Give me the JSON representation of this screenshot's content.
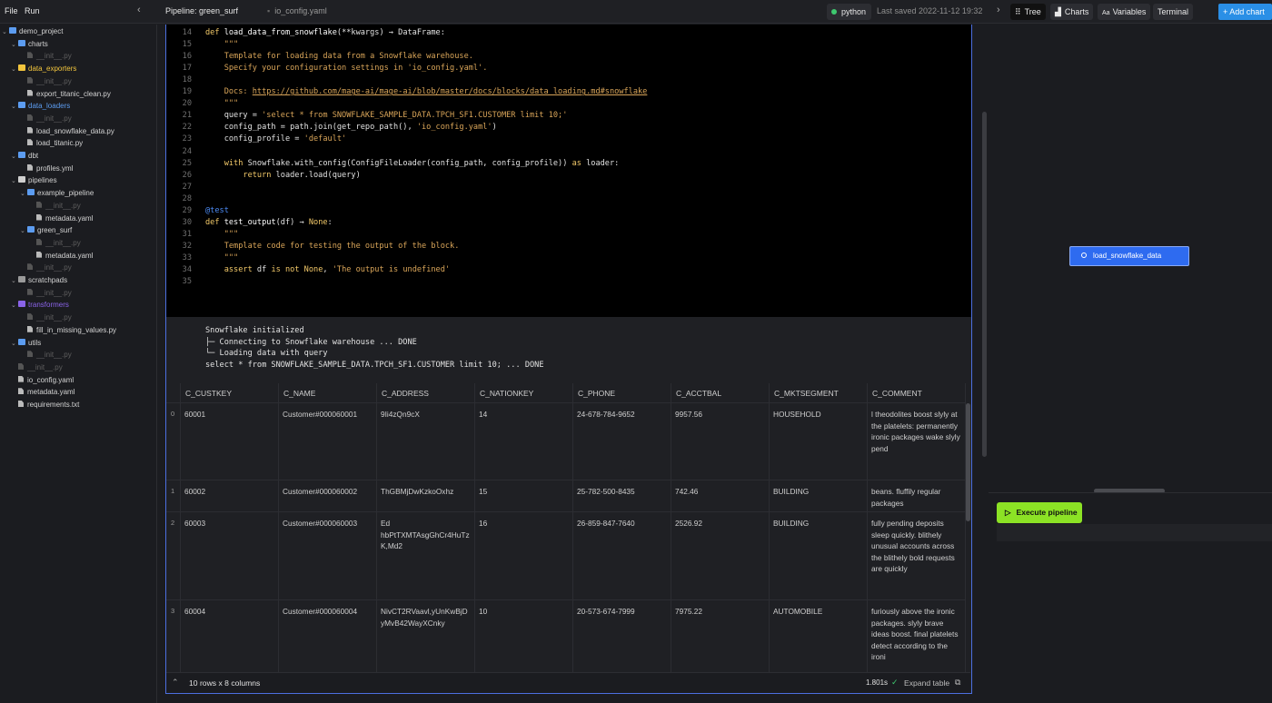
{
  "menu": {
    "file": "File",
    "run": "Run"
  },
  "tabs": {
    "pipeline": "Pipeline: green_surf",
    "ioconfig": "io_config.yaml"
  },
  "lang": "python",
  "last_saved": "Last saved 2022-11-12 19:32",
  "right_tabs": {
    "tree": "Tree",
    "charts": "Charts",
    "variables": "Variables",
    "terminal": "Terminal",
    "add_chart": "+ Add chart"
  },
  "tree": [
    {
      "label": "demo_project",
      "depth": 0,
      "type": "folder",
      "color": "#5c9cf0",
      "expanded": true
    },
    {
      "label": "charts",
      "depth": 1,
      "type": "folder",
      "color": "#5c9cf0",
      "expanded": true
    },
    {
      "label": "__init__.py",
      "depth": 2,
      "type": "file",
      "dim": true
    },
    {
      "label": "data_exporters",
      "depth": 1,
      "type": "folder",
      "color": "#f2c53d",
      "expanded": true,
      "labelColor": "#f2c53d"
    },
    {
      "label": "__init__.py",
      "depth": 2,
      "type": "file",
      "dim": true
    },
    {
      "label": "export_titanic_clean.py",
      "depth": 2,
      "type": "file"
    },
    {
      "label": "data_loaders",
      "depth": 1,
      "type": "folder",
      "color": "#5c9cf0",
      "expanded": true,
      "labelColor": "#5c9cf0"
    },
    {
      "label": "__init__.py",
      "depth": 2,
      "type": "file",
      "dim": true
    },
    {
      "label": "load_snowflake_data.py",
      "depth": 2,
      "type": "file"
    },
    {
      "label": "load_titanic.py",
      "depth": 2,
      "type": "file"
    },
    {
      "label": "dbt",
      "depth": 1,
      "type": "folder",
      "color": "#5c9cf0",
      "expanded": true
    },
    {
      "label": "profiles.yml",
      "depth": 2,
      "type": "file"
    },
    {
      "label": "pipelines",
      "depth": 1,
      "type": "folder",
      "color": "#cfcfcf",
      "expanded": true
    },
    {
      "label": "example_pipeline",
      "depth": 2,
      "type": "folder",
      "color": "#5c9cf0",
      "expanded": true
    },
    {
      "label": "__init__.py",
      "depth": 3,
      "type": "file",
      "dim": true
    },
    {
      "label": "metadata.yaml",
      "depth": 3,
      "type": "file"
    },
    {
      "label": "green_surf",
      "depth": 2,
      "type": "folder",
      "color": "#5c9cf0",
      "expanded": true
    },
    {
      "label": "__init__.py",
      "depth": 3,
      "type": "file",
      "dim": true
    },
    {
      "label": "metadata.yaml",
      "depth": 3,
      "type": "file"
    },
    {
      "label": "__init__.py",
      "depth": 2,
      "type": "file",
      "dim": true
    },
    {
      "label": "scratchpads",
      "depth": 1,
      "type": "folder",
      "color": "#9a9a9a",
      "expanded": true
    },
    {
      "label": "__init__.py",
      "depth": 2,
      "type": "file",
      "dim": true
    },
    {
      "label": "transformers",
      "depth": 1,
      "type": "folder",
      "color": "#8a63e8",
      "expanded": true,
      "labelColor": "#8a63e8"
    },
    {
      "label": "__init__.py",
      "depth": 2,
      "type": "file",
      "dim": true
    },
    {
      "label": "fill_in_missing_values.py",
      "depth": 2,
      "type": "file"
    },
    {
      "label": "utils",
      "depth": 1,
      "type": "folder",
      "color": "#5c9cf0",
      "expanded": true
    },
    {
      "label": "__init__.py",
      "depth": 2,
      "type": "file",
      "dim": true
    },
    {
      "label": "__init__.py",
      "depth": 1,
      "type": "file",
      "dim": true
    },
    {
      "label": "io_config.yaml",
      "depth": 1,
      "type": "file"
    },
    {
      "label": "metadata.yaml",
      "depth": 1,
      "type": "file"
    },
    {
      "label": "requirements.txt",
      "depth": 1,
      "type": "file"
    }
  ],
  "code": [
    {
      "n": "14",
      "tokens": [
        [
          "kw",
          "def "
        ],
        [
          "fn",
          "load_data_from_snowflake"
        ],
        [
          "pl",
          "(**kwargs) → "
        ],
        [
          "pl",
          "DataFrame:"
        ]
      ]
    },
    {
      "n": "15",
      "tokens": [
        [
          "cm",
          "    \"\"\""
        ]
      ]
    },
    {
      "n": "16",
      "tokens": [
        [
          "cm",
          "    Template for loading data from a Snowflake warehouse."
        ]
      ]
    },
    {
      "n": "17",
      "tokens": [
        [
          "cm",
          "    Specify your configuration settings in 'io_config.yaml'."
        ]
      ]
    },
    {
      "n": "18",
      "tokens": []
    },
    {
      "n": "19",
      "tokens": [
        [
          "cm",
          "    Docs: "
        ],
        [
          "link",
          "https://github.com/mage-ai/mage-ai/blob/master/docs/blocks/data_loading.md#snowflake"
        ]
      ]
    },
    {
      "n": "20",
      "tokens": [
        [
          "cm",
          "    \"\"\""
        ]
      ]
    },
    {
      "n": "21",
      "tokens": [
        [
          "pl",
          "    query = "
        ],
        [
          "str",
          "'select * from SNOWFLAKE_SAMPLE_DATA.TPCH_SF1.CUSTOMER limit 10;'"
        ]
      ]
    },
    {
      "n": "22",
      "tokens": [
        [
          "pl",
          "    config_path = path.join(get_repo_path(), "
        ],
        [
          "str",
          "'io_config.yaml'"
        ],
        [
          "pl",
          ")"
        ]
      ]
    },
    {
      "n": "23",
      "tokens": [
        [
          "pl",
          "    config_profile = "
        ],
        [
          "str",
          "'default'"
        ]
      ]
    },
    {
      "n": "24",
      "tokens": []
    },
    {
      "n": "25",
      "tokens": [
        [
          "kw",
          "    with "
        ],
        [
          "pl",
          "Snowflake.with_config(ConfigFileLoader(config_path, config_profile)) "
        ],
        [
          "kw",
          "as "
        ],
        [
          "pl",
          "loader:"
        ]
      ]
    },
    {
      "n": "26",
      "tokens": [
        [
          "kw",
          "        return "
        ],
        [
          "pl",
          "loader.load(query)"
        ]
      ]
    },
    {
      "n": "27",
      "tokens": []
    },
    {
      "n": "28",
      "tokens": []
    },
    {
      "n": "29",
      "tokens": [
        [
          "dec",
          "@test"
        ]
      ]
    },
    {
      "n": "30",
      "tokens": [
        [
          "kw",
          "def "
        ],
        [
          "fn",
          "test_output"
        ],
        [
          "pl",
          "(df) → "
        ],
        [
          "kw",
          "None"
        ],
        [
          "pl",
          ":"
        ]
      ]
    },
    {
      "n": "31",
      "tokens": [
        [
          "cm",
          "    \"\"\""
        ]
      ]
    },
    {
      "n": "32",
      "tokens": [
        [
          "cm",
          "    Template code for testing the output of the block."
        ]
      ]
    },
    {
      "n": "33",
      "tokens": [
        [
          "cm",
          "    \"\"\""
        ]
      ]
    },
    {
      "n": "34",
      "tokens": [
        [
          "kw",
          "    assert "
        ],
        [
          "pl",
          "df "
        ],
        [
          "kw",
          "is not None"
        ],
        [
          "pl",
          ", "
        ],
        [
          "str",
          "'The output is undefined'"
        ]
      ]
    },
    {
      "n": "35",
      "tokens": []
    }
  ],
  "output_lines": [
    "Snowflake initialized",
    "├─ Connecting to Snowflake warehouse ... DONE",
    "└─ Loading data with query",
    "select * from SNOWFLAKE_SAMPLE_DATA.TPCH_SF1.CUSTOMER limit 10; ... DONE"
  ],
  "table": {
    "columns": [
      "C_CUSTKEY",
      "C_NAME",
      "C_ADDRESS",
      "C_NATIONKEY",
      "C_PHONE",
      "C_ACCTBAL",
      "C_MKTSEGMENT",
      "C_COMMENT"
    ],
    "rows": [
      {
        "idx": "0",
        "cells": [
          "60001",
          "Customer#000060001",
          "9Ii4zQn9cX",
          "14",
          "24-678-784-9652",
          "9957.56",
          "HOUSEHOLD",
          "l theodolites boost slyly at the platelets: permanently ironic packages wake slyly pend"
        ]
      },
      {
        "idx": "1",
        "cells": [
          "60002",
          "Customer#000060002",
          "ThGBMjDwKzkoOxhz",
          "15",
          "25-782-500-8435",
          "742.46",
          "BUILDING",
          "beans. fluffily regular packages"
        ]
      },
      {
        "idx": "2",
        "cells": [
          "60003",
          "Customer#000060003",
          "Ed hbPtTXMTAsgGhCr4HuTzK,Md2",
          "16",
          "26-859-847-7640",
          "2526.92",
          "BUILDING",
          "fully pending deposits sleep quickly. blithely unusual accounts across the blithely bold requests are quickly"
        ]
      },
      {
        "idx": "3",
        "cells": [
          "60004",
          "Customer#000060004",
          "NivCT2RVaavl,yUnKwBjDyMvB42WayXCnky",
          "10",
          "20-573-674-7999",
          "7975.22",
          "AUTOMOBILE",
          "furiously above the ironic packages. slyly brave ideas boost. final platelets detect according to the ironi"
        ]
      }
    ]
  },
  "footer": {
    "rows": "10 rows x 8 columns",
    "time": "1.801s",
    "expand": "Expand table"
  },
  "graph_node": "load_snowflake_data",
  "execute_button": "Execute pipeline"
}
